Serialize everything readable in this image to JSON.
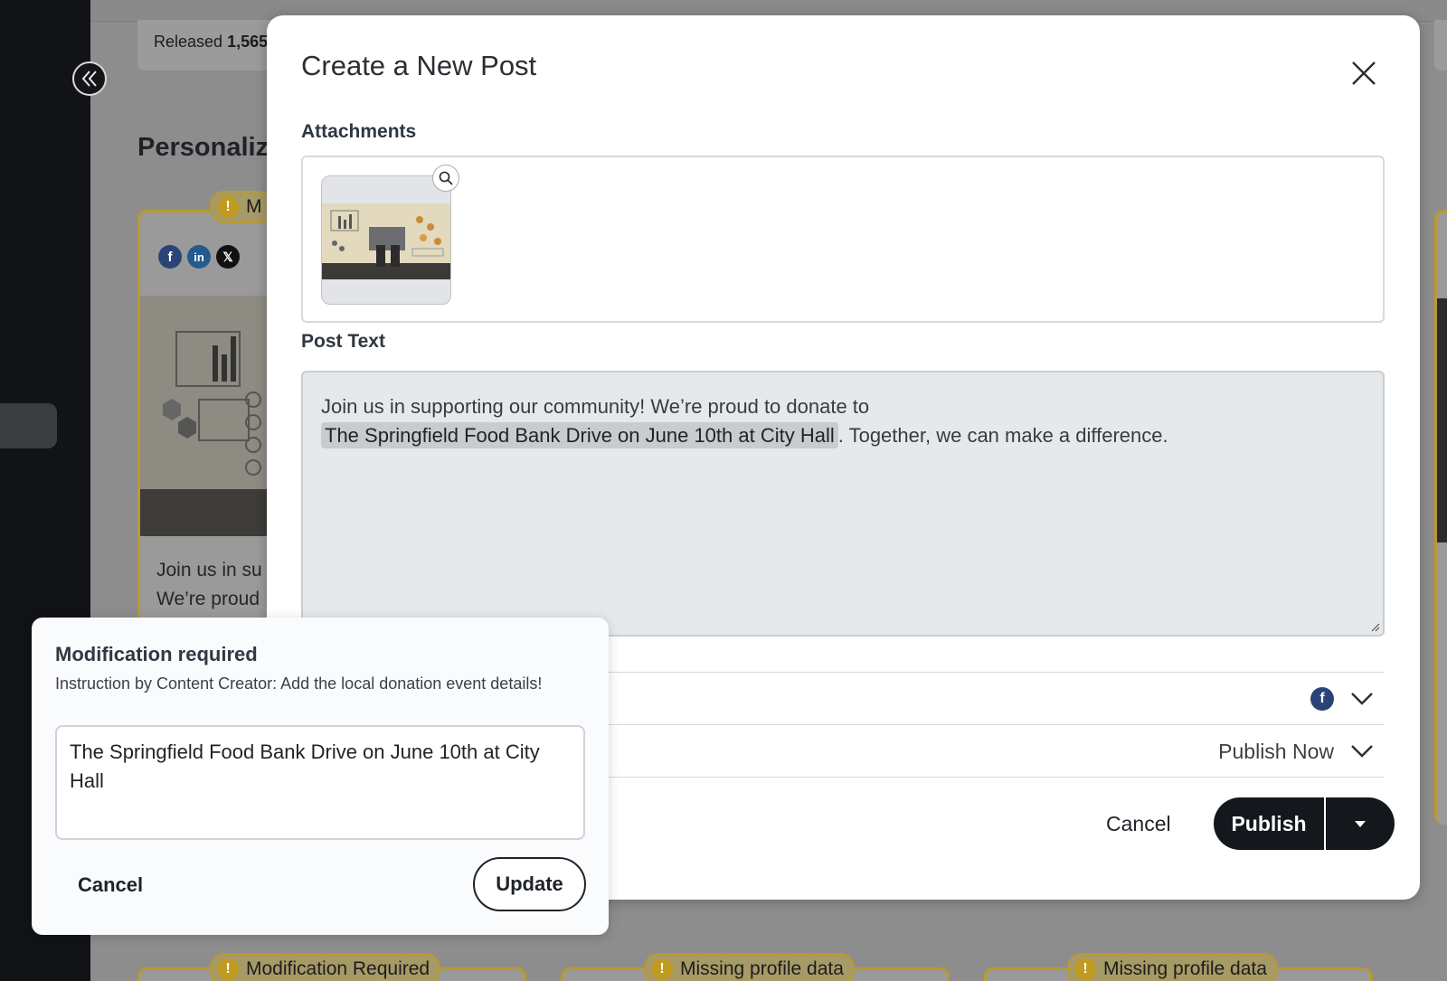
{
  "background": {
    "released_label": "Released",
    "released_count": "1,565",
    "section_heading": "Personalize",
    "card_badge": "M",
    "card_text_line1": "Join us in su",
    "card_text_line2": "We’re proud",
    "bottom_badges": [
      "Modification Required",
      "Missing profile data",
      "Missing profile data"
    ],
    "social_networks": [
      "facebook-icon",
      "linkedin-icon",
      "x-icon"
    ]
  },
  "modal": {
    "title": "Create a New Post",
    "attachments_label": "Attachments",
    "post_text_label": "Post Text",
    "post_text_before": "Join us in supporting our community! We’re proud to donate to",
    "post_text_highlight": "The Springfield Food Bank Drive on June 10th at City Hall",
    "post_text_after": ". Together, we can make a difference.",
    "network_row_icon": "facebook-icon",
    "schedule_value": "Publish Now",
    "cancel_label": "Cancel",
    "publish_label": "Publish"
  },
  "popover": {
    "title": "Modification required",
    "instruction": "Instruction by Content Creator: Add the local donation event details!",
    "textarea_value": "The Springfield Food Bank Drive on June 10th at City Hall",
    "cancel_label": "Cancel",
    "update_label": "Update"
  },
  "colors": {
    "warning_accent": "#c19a22",
    "primary_button": "#14171b",
    "facebook": "#3b5998"
  }
}
